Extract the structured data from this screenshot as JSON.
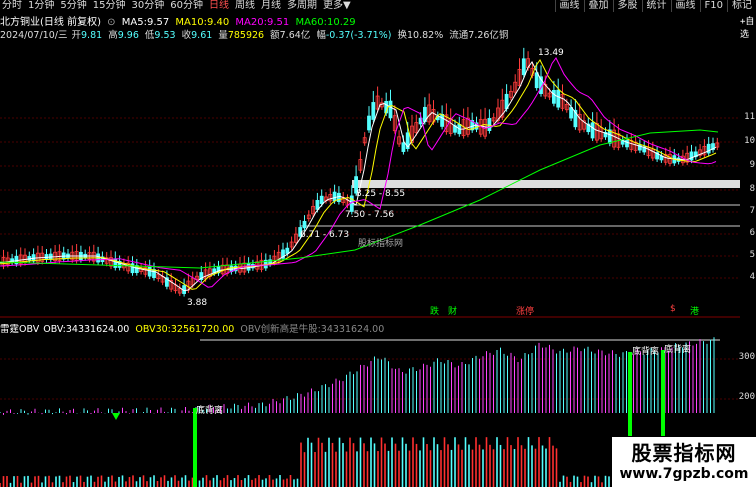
{
  "toolbar": {
    "periods": [
      "分时",
      "1分钟",
      "5分钟",
      "15分钟",
      "30分钟",
      "60分钟",
      "日线",
      "周线",
      "月线",
      "多周期",
      "更多"
    ],
    "active_index": 6,
    "more_arrow": "▼",
    "buttons": [
      "画线",
      "叠加",
      "多股",
      "统计",
      "画线",
      "F10",
      "标记"
    ]
  },
  "stock": {
    "name": "北方铜业(日线 前复权)",
    "ma5_label": "MA5:",
    "ma5": "9.57",
    "ma10_label": "MA10:",
    "ma10": "9.40",
    "ma20_label": "MA20:",
    "ma20": "9.51",
    "ma60_label": "MA60:",
    "ma60": "10.29"
  },
  "bar_info": {
    "date": "2024/07/10/三",
    "open_label": "开",
    "open": "9.81",
    "high_label": "高",
    "high": "9.96",
    "low_label": "低",
    "low": "9.53",
    "close_label": "收",
    "close": "9.61",
    "volume_label": "量",
    "volume": "785926",
    "amount_label": "额",
    "amount": "7.64亿",
    "change_label": "幅",
    "change": "-0.37(-3.71%)",
    "turnover_label": "换",
    "turnover": "10.82%",
    "float_label": "流通",
    "float_shares": "7.26亿",
    "float_suffix": "铜"
  },
  "right_axis": {
    "top": "+自选",
    "ticks": [
      "11",
      "10",
      "9",
      "8",
      "7",
      "6",
      "5",
      "4",
      "300",
      "200"
    ]
  },
  "annotations": {
    "high_price": "13.49",
    "low_price": "3.88",
    "range1": "8.25 - 8.55",
    "range2": "7.50 - 7.56",
    "range3": "6.71 - 6.73",
    "chart_watermark": "股标指标网",
    "event1": "跌",
    "event2": "财",
    "event3": "涨停",
    "event4": "$",
    "event5": "港"
  },
  "obv_panel": {
    "title_name": "雷霆OBV",
    "obv_label": "OBV:",
    "obv": "34331624.00",
    "obv30_label": "OBV30:",
    "obv30": "32561720.00",
    "obv_new_high_label": "OBV创新高是牛股:",
    "obv_new_high": "34331624.00",
    "divergence_labels": [
      "底背离",
      "底背离",
      "底背离"
    ]
  },
  "watermark": {
    "line1": "股票指标网",
    "line2": "www.7gpzb.com"
  },
  "colors": {
    "up": "#ff3c3c",
    "down": "#54ffff",
    "ma5": "#ffffff",
    "ma10": "#ffff00",
    "ma20": "#ff00ff",
    "ma60": "#00ff00",
    "highlight": "#ff5050",
    "grid": "#4a0000",
    "obv_up": "#ff44ff",
    "obv_down": "#54ffff",
    "divergence": "#00ff00"
  }
}
